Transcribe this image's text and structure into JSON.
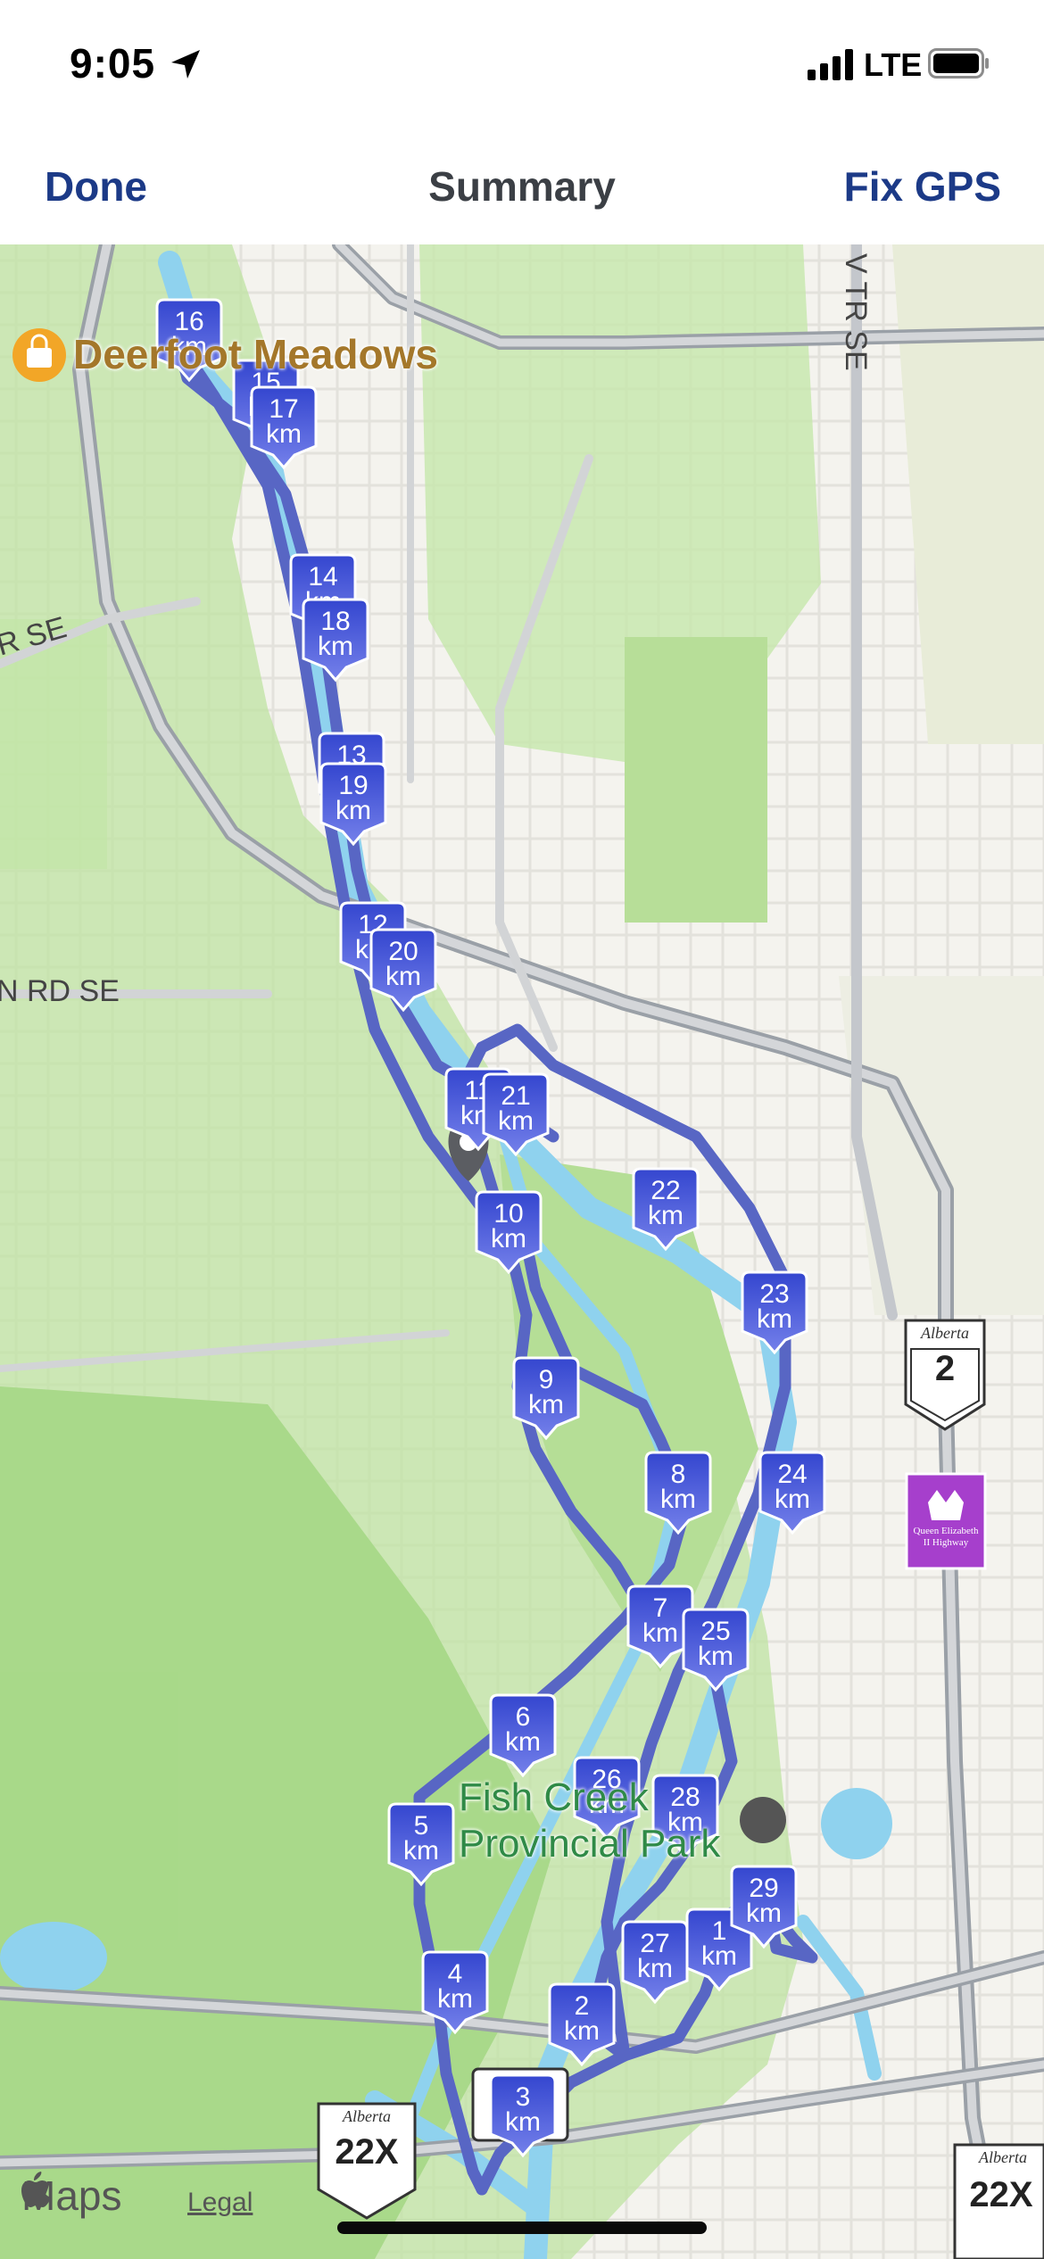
{
  "status_bar": {
    "time": "9:05",
    "network": "LTE",
    "icons": [
      "location-arrow-icon",
      "signal-bars-icon",
      "battery-icon"
    ]
  },
  "nav": {
    "left_button": "Done",
    "title": "Summary",
    "right_button": "Fix GPS",
    "accent_color": "#1c3a87"
  },
  "map": {
    "place_labels": {
      "deerfoot": "Deerfoot Meadows",
      "park_line1": "Fish Creek",
      "park_line2": "Provincial Park"
    },
    "road_labels": {
      "road_r_se": "R SE",
      "road_n_rd_se": "N RD SE",
      "road_v_tr_se": "V TR SE"
    },
    "shields": {
      "alberta_2": {
        "brand": "Alberta",
        "number": "2"
      },
      "alberta_22x_left": {
        "brand": "Alberta",
        "number": "22X"
      },
      "alberta_22x_right": {
        "brand": "Alberta",
        "number": "22X"
      },
      "qe2": {
        "caption": "Queen Elizabeth II Highway"
      }
    },
    "km_markers": [
      "1",
      "2",
      "3",
      "4",
      "5",
      "6",
      "7",
      "8",
      "9",
      "10",
      "11",
      "12",
      "13",
      "14",
      "15",
      "16",
      "17",
      "18",
      "19",
      "20",
      "21",
      "22",
      "23",
      "24",
      "25",
      "26",
      "27",
      "28",
      "29"
    ],
    "unit": "km",
    "footer": {
      "maps_brand": "Maps",
      "legal_link": "Legal"
    },
    "route_color": "#5b6bc8",
    "marker_color": "#3d4fd0"
  }
}
